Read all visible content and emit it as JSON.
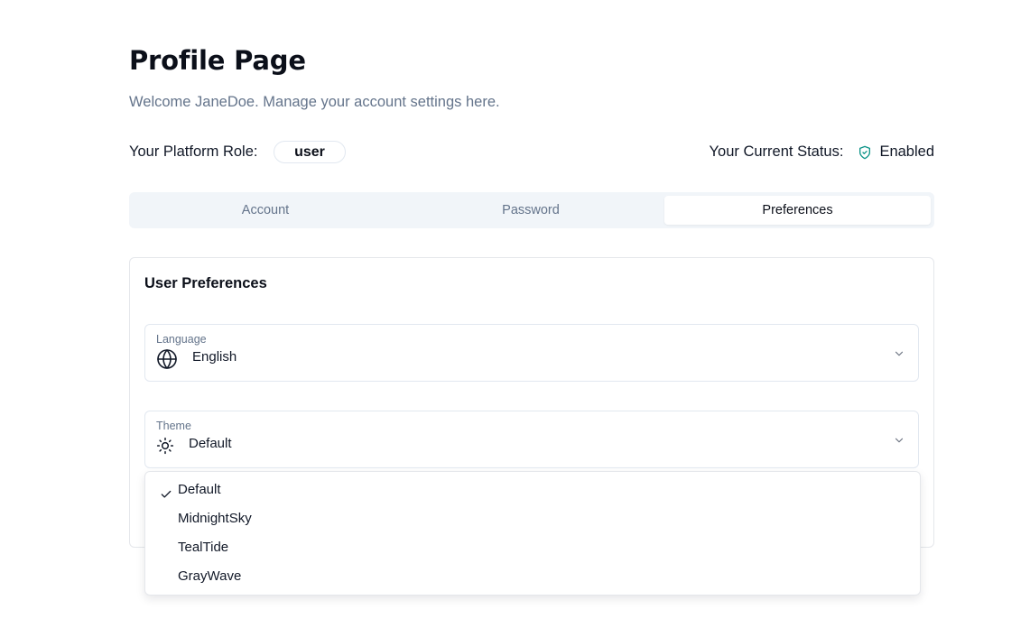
{
  "header": {
    "title": "Profile Page",
    "subtitle": "Welcome JaneDoe. Manage your account settings here."
  },
  "role": {
    "label": "Your Platform Role:",
    "value": "user"
  },
  "status": {
    "label": "Your Current Status:",
    "value": "Enabled",
    "icon": "shield-check-icon",
    "icon_color": "#0d9488"
  },
  "tabs": [
    {
      "label": "Account",
      "active": false
    },
    {
      "label": "Password",
      "active": false
    },
    {
      "label": "Preferences",
      "active": true
    }
  ],
  "preferences": {
    "title": "User Preferences",
    "language": {
      "label": "Language",
      "value": "English",
      "icon": "globe-icon"
    },
    "theme": {
      "label": "Theme",
      "value": "Default",
      "icon": "sun-icon"
    }
  },
  "theme_options": [
    {
      "label": "Default",
      "selected": true
    },
    {
      "label": "MidnightSky",
      "selected": false
    },
    {
      "label": "TealTide",
      "selected": false
    },
    {
      "label": "GrayWave",
      "selected": false
    }
  ]
}
